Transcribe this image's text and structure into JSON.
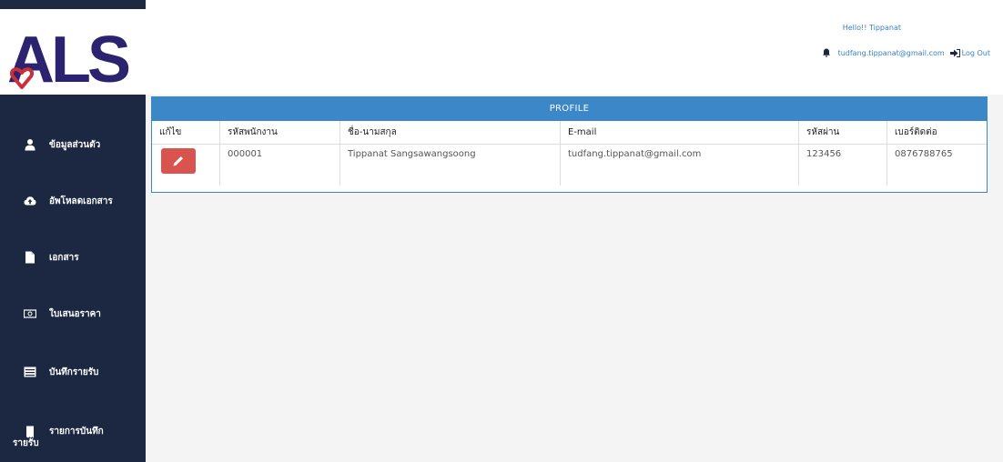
{
  "brand": {
    "logo_text": "ALS",
    "colors": {
      "navy": "#1c2842",
      "heart": "#c9303a",
      "accent": "#3b87c8",
      "edit_button": "#d9534f"
    }
  },
  "header": {
    "greeting": "Hello!! Tippanat",
    "email": "tudfang.tippanat@gmail.com",
    "logout_label": "Log Out",
    "icons": {
      "bell": "bell-icon",
      "logout": "sign-out-icon"
    }
  },
  "sidebar": {
    "items": [
      {
        "label": "ข้อมูลส่วนตัว",
        "icon": "user-icon"
      },
      {
        "label": "อัพโหลดเอกสาร",
        "icon": "cloud-upload-icon"
      },
      {
        "label": "เอกสาร",
        "icon": "file-icon"
      },
      {
        "label": "ใบเสนอราคา",
        "icon": "money-icon"
      },
      {
        "label": "บันทึกรายรับ",
        "icon": "list-icon"
      },
      {
        "label_line1": "รายการบันทึก",
        "label_line2": "รายรับ",
        "icon": "receipt-icon"
      }
    ]
  },
  "panel": {
    "title": "PROFILE",
    "columns": [
      "แก้ไข",
      "รหัสพนักงาน",
      "ชื่อ-นามสกุล",
      "E-mail",
      "รหัสผ่าน",
      "เบอร์ติดต่อ"
    ],
    "rows": [
      {
        "employee_id": "000001",
        "name": "Tippanat Sangsawangsoong",
        "email": "tudfang.tippanat@gmail.com",
        "password": "123456",
        "phone": "0876788765"
      }
    ],
    "edit_icon": "pencil-icon"
  }
}
